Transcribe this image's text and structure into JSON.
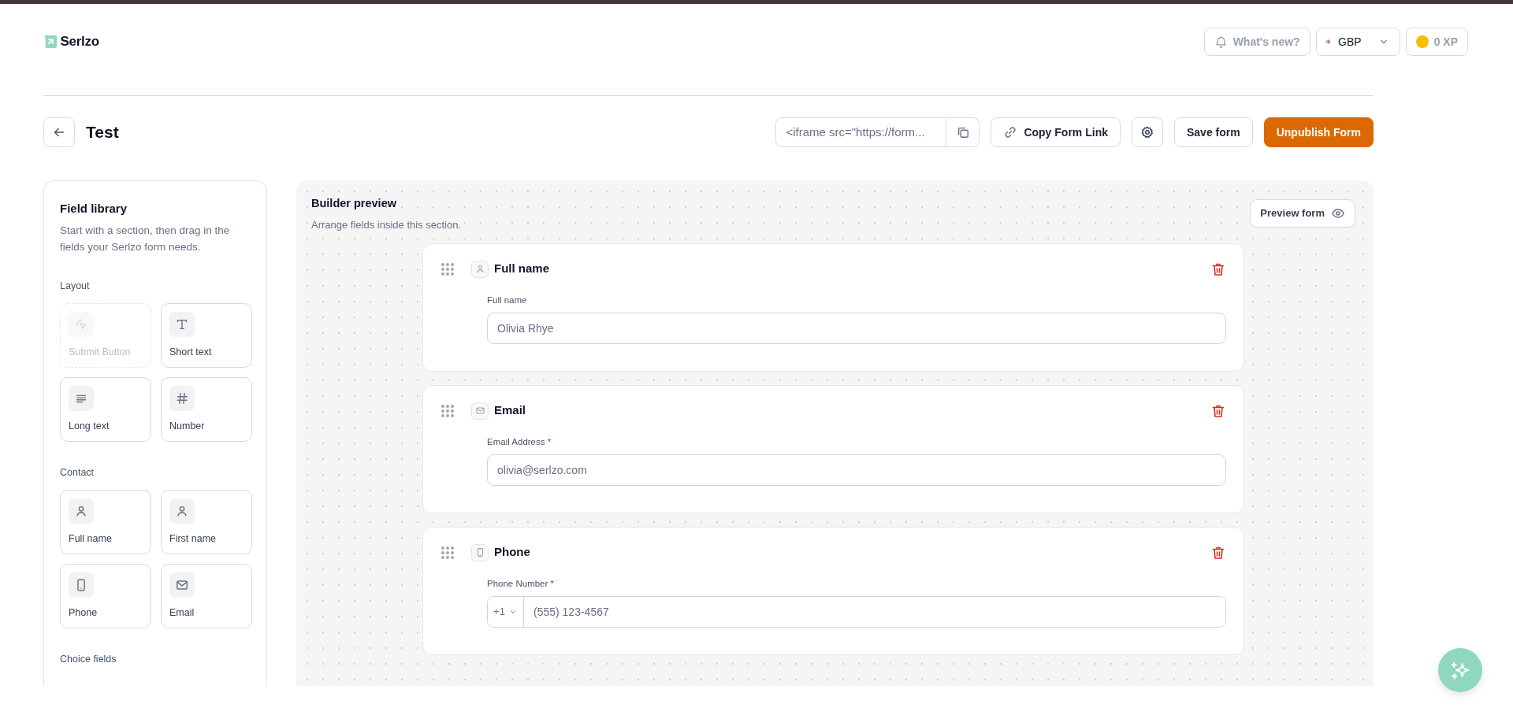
{
  "brand": {
    "name": "Serlzo"
  },
  "header_actions": {
    "whats_new": "What's new?",
    "currency": "GBP",
    "xp": "0 XP"
  },
  "toolbar": {
    "title": "Test",
    "embed_code": "<iframe src=\"https://form...",
    "copy_link": "Copy Form Link",
    "save": "Save form",
    "publish": "Unpublish Form"
  },
  "field_library": {
    "title": "Field library",
    "description": "Start with a section, then drag in the fields your Serlzo form needs.",
    "groups": [
      {
        "label": "Layout",
        "items": [
          {
            "kind": "cursor",
            "label": "Submit Button",
            "disabled": true
          },
          {
            "kind": "text",
            "label": "Short text",
            "disabled": false
          },
          {
            "kind": "paragraph",
            "label": "Long text",
            "disabled": false
          },
          {
            "kind": "number",
            "label": "Number",
            "disabled": false
          }
        ]
      },
      {
        "label": "Contact",
        "items": [
          {
            "kind": "person",
            "label": "Full name",
            "disabled": false
          },
          {
            "kind": "person",
            "label": "First name",
            "disabled": false
          },
          {
            "kind": "phone",
            "label": "Phone",
            "disabled": false
          },
          {
            "kind": "email",
            "label": "Email",
            "disabled": false
          }
        ]
      },
      {
        "label": "Choice fields"
      }
    ]
  },
  "builder": {
    "title": "Builder preview",
    "subtitle": "Arrange fields inside this section.",
    "preview_button": "Preview form",
    "fields": [
      {
        "kind": "person",
        "title": "Full name",
        "label": "Full name",
        "placeholder": "Olivia Rhye"
      },
      {
        "kind": "email",
        "title": "Email",
        "label": "Email Address",
        "required_mark": "*",
        "placeholder": "olivia@serlzo.com"
      },
      {
        "kind": "phone",
        "title": "Phone",
        "label": "Phone Number",
        "required_mark": "*",
        "country_code": "+1",
        "placeholder": "(555) 123-4567"
      }
    ]
  }
}
